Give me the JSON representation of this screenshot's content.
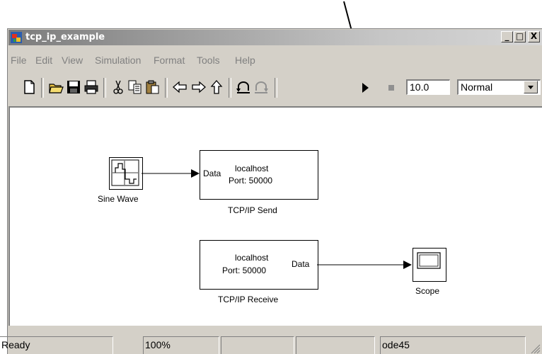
{
  "window": {
    "title": "tcp_ip_example"
  },
  "titlebar_buttons": {
    "minimize": "_",
    "maximize": "□",
    "close": "X"
  },
  "menu": [
    "File",
    "Edit",
    "View",
    "Simulation",
    "Format",
    "Tools",
    "Help"
  ],
  "toolbar": {
    "icons": [
      "new-icon",
      "open-icon",
      "save-icon",
      "print-icon",
      "cut-icon",
      "copy-icon",
      "paste-icon",
      "back-icon",
      "forward-icon",
      "up-icon",
      "undo-icon",
      "redo-icon",
      "play-icon",
      "stop-icon"
    ],
    "stop_time": "10.0",
    "sim_mode": "Normal"
  },
  "blocks": {
    "sine_wave": {
      "label": "Sine Wave"
    },
    "tcp_send": {
      "label": "TCP/IP Send",
      "port_in": "Data",
      "host": "localhost",
      "port": "Port: 50000"
    },
    "tcp_receive": {
      "label": "TCP/IP Receive",
      "port_out": "Data",
      "host": "localhost",
      "port": "Port: 50000"
    },
    "scope": {
      "label": "Scope"
    }
  },
  "status": {
    "state": "Ready",
    "zoom": "100%",
    "solver": "ode45"
  },
  "colors": {
    "window_bg": "#d4d0c8",
    "canvas_bg": "#ffffff",
    "menu_text": "#808080"
  }
}
